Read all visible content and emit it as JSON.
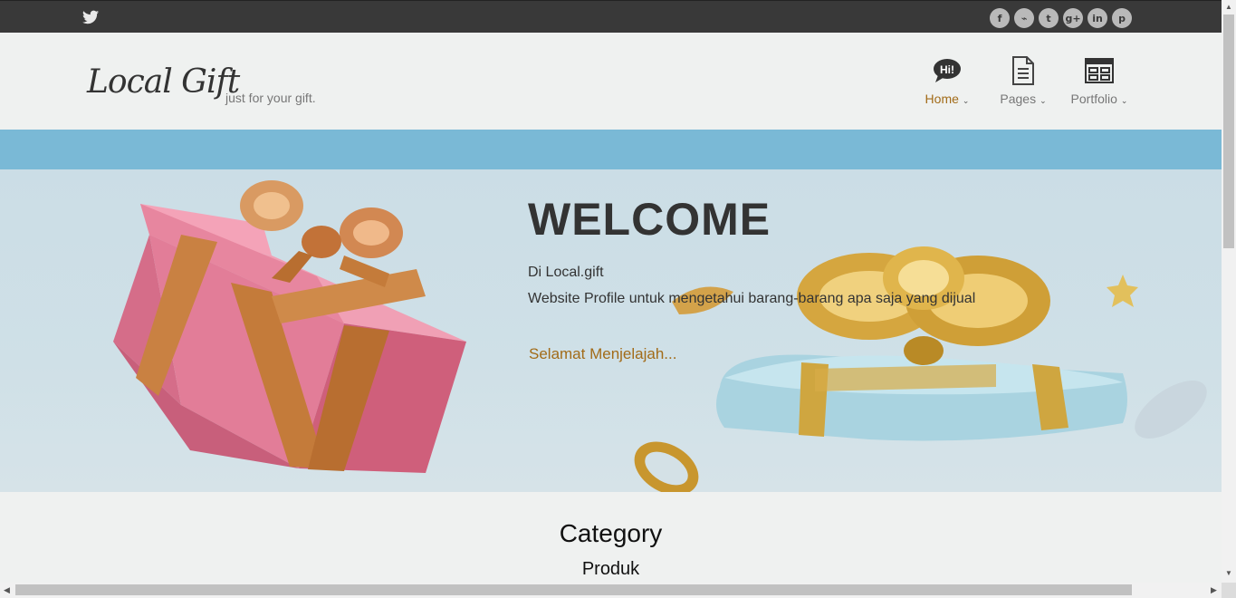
{
  "topbar": {
    "social": [
      {
        "icon": "facebook-icon",
        "glyph": "f"
      },
      {
        "icon": "rss-icon",
        "glyph": "⌁"
      },
      {
        "icon": "twitter-icon",
        "glyph": "t"
      },
      {
        "icon": "google-plus-icon",
        "glyph": "g+"
      },
      {
        "icon": "linkedin-icon",
        "glyph": "in"
      },
      {
        "icon": "pinterest-icon",
        "glyph": "p"
      }
    ]
  },
  "header": {
    "logo": "Local Gift",
    "tagline": "just for your gift."
  },
  "nav": {
    "home": "Home",
    "home_badge": "Hi!",
    "pages": "Pages",
    "portfolio": "Portfolio"
  },
  "hero": {
    "title": "WELCOME",
    "line1": "Di Local.gift",
    "line2": "Website Profile untuk mengetahui barang-barang apa saja yang dijual",
    "cta": "Selamat Menjelajah..."
  },
  "category": {
    "title": "Category",
    "subtitle": "Produk"
  },
  "colors": {
    "accent": "#a26b18",
    "topbar": "#393939",
    "strip": "#7ab9d6"
  }
}
